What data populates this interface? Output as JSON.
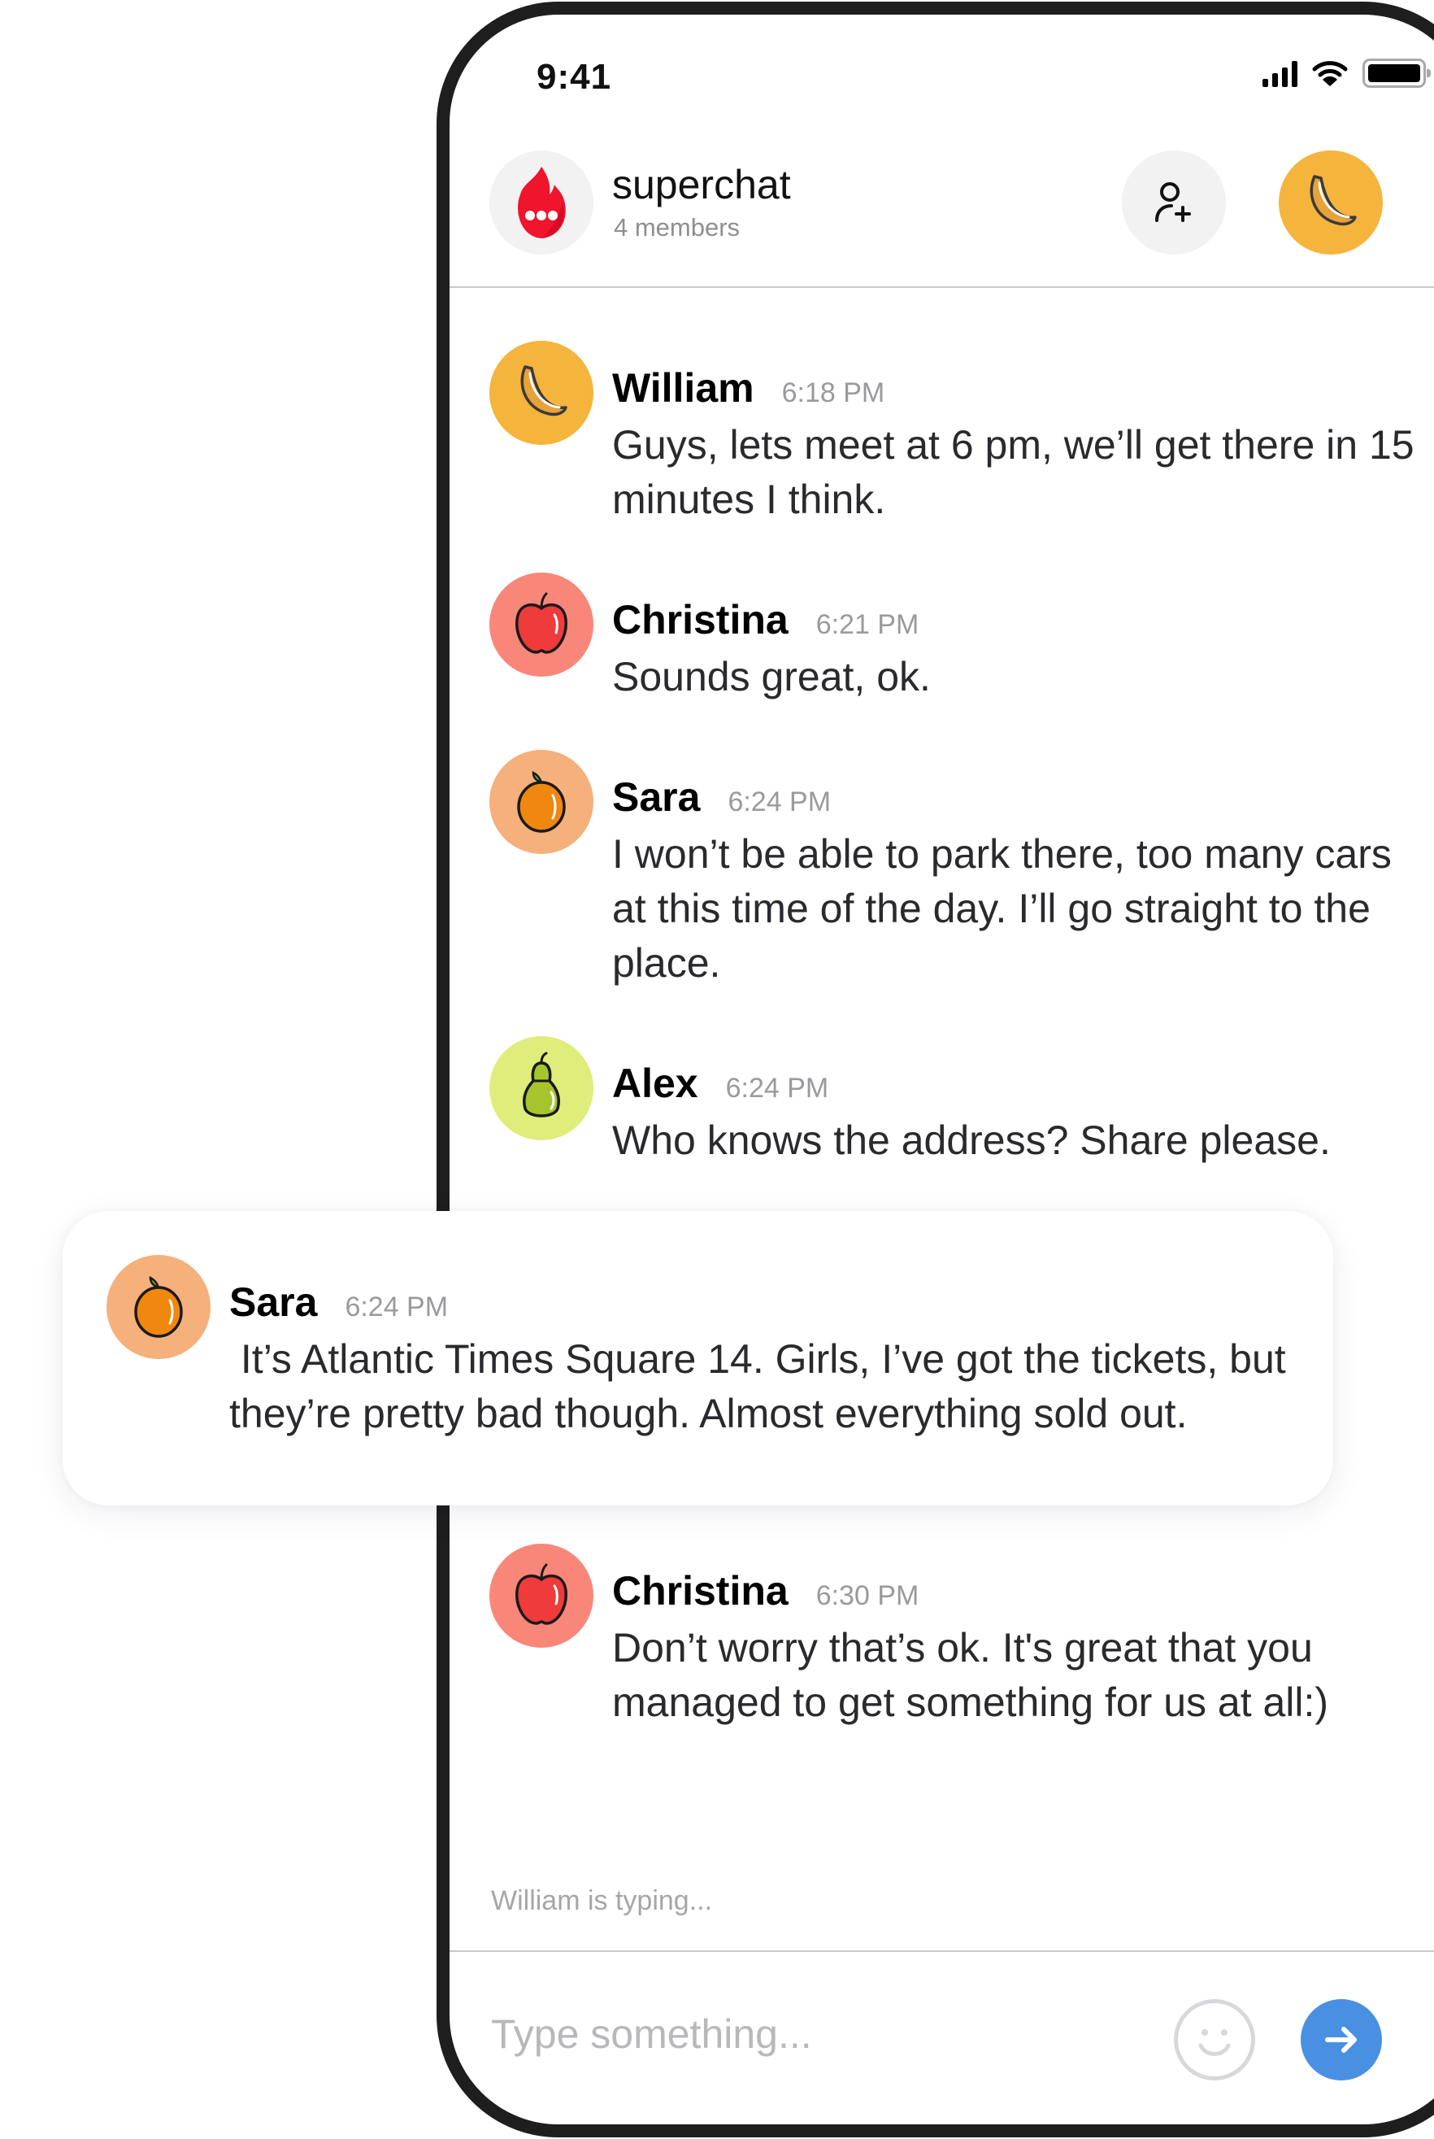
{
  "status_bar": {
    "time": "9:41",
    "icons": [
      "cellular-signal-icon",
      "wifi-icon",
      "battery-icon"
    ]
  },
  "header": {
    "title": "superchat",
    "subtitle": "4 members",
    "logo_icon": "flame-chat-icon",
    "add_member_icon": "add-user-icon",
    "profile_icon": "banana-icon"
  },
  "colors": {
    "accent_blue": "#4a90e2",
    "banana_bg": "#f5b43c",
    "apple_bg": "#f8877a",
    "orange_bg": "#f5b07c",
    "pear_bg": "#dfed7a",
    "logo_red": "#f0142d"
  },
  "messages": [
    {
      "author": "William",
      "time": "6:18 PM",
      "avatar": "banana-icon",
      "text": "Guys, lets meet at 6 pm, we’ll get there in 15 minutes I think."
    },
    {
      "author": "Christina",
      "time": "6:21 PM",
      "avatar": "apple-icon",
      "text": "Sounds great, ok."
    },
    {
      "author": "Sara",
      "time": "6:24 PM",
      "avatar": "orange-icon",
      "text": "I won’t be able to park there, too many cars at this time of the day. I’ll go straight to the place."
    },
    {
      "author": "Alex",
      "time": "6:24 PM",
      "avatar": "pear-icon",
      "text": "Who knows the address? Share please."
    },
    {
      "author": "Christina",
      "time": "6:30 PM",
      "avatar": "apple-icon",
      "text": "Don’t worry that’s ok. It's great that you managed to get something for us at all:)"
    }
  ],
  "highlighted_message": {
    "author": "Sara",
    "time": "6:24 PM",
    "avatar": "orange-icon",
    "text": " It’s Atlantic Times Square 14. Girls, I’ve got the tickets, but they’re pretty bad though. Almost everything sold out."
  },
  "typing_indicator": "William is typing...",
  "composer": {
    "placeholder": "Type something...",
    "value": "",
    "emoji_icon": "smiley-icon",
    "send_icon": "arrow-right-icon"
  }
}
